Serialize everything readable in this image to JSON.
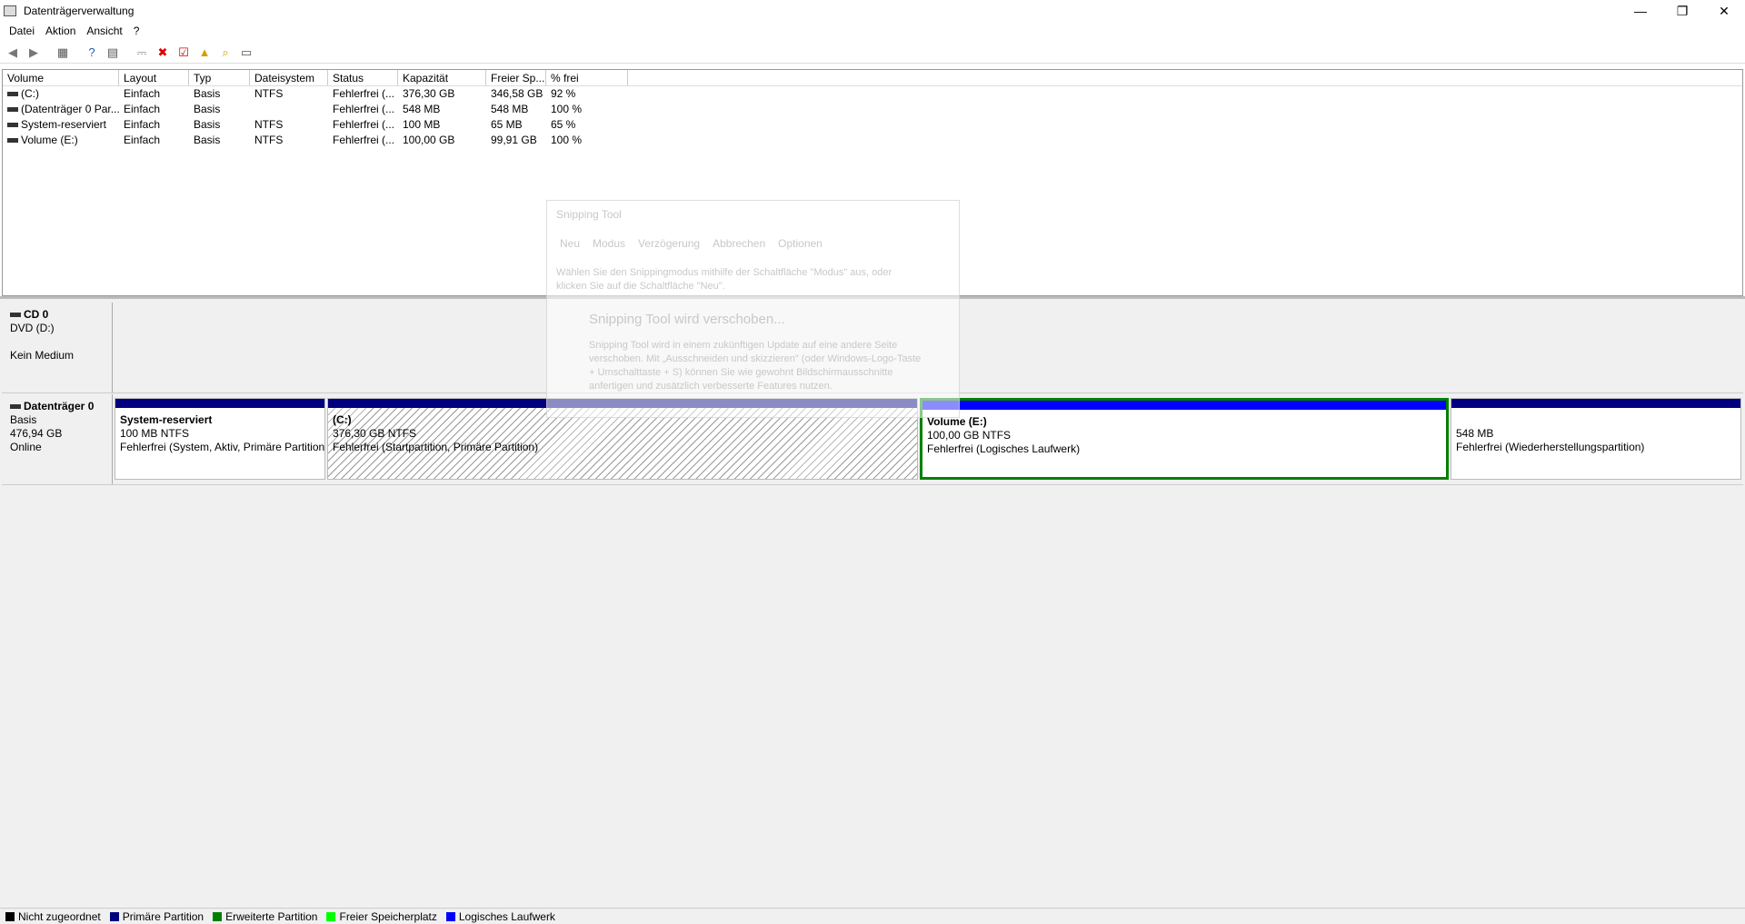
{
  "window": {
    "title": "Datenträgerverwaltung",
    "minimize": "—",
    "maximize": "❐",
    "close": "✕"
  },
  "menu": [
    "Datei",
    "Aktion",
    "Ansicht",
    "?"
  ],
  "columns": [
    "Volume",
    "Layout",
    "Typ",
    "Dateisystem",
    "Status",
    "Kapazität",
    "Freier Sp...",
    "% frei"
  ],
  "volumes": [
    [
      "(C:)",
      "Einfach",
      "Basis",
      "NTFS",
      "Fehlerfrei (...",
      "376,30 GB",
      "346,58 GB",
      "92 %"
    ],
    [
      "(Datenträger 0 Par...",
      "Einfach",
      "Basis",
      "",
      "Fehlerfrei (...",
      "548 MB",
      "548 MB",
      "100 %"
    ],
    [
      "System-reserviert",
      "Einfach",
      "Basis",
      "NTFS",
      "Fehlerfrei (...",
      "100 MB",
      "65 MB",
      "65 %"
    ],
    [
      "Volume (E:)",
      "Einfach",
      "Basis",
      "NTFS",
      "Fehlerfrei (...",
      "100,00 GB",
      "99,91 GB",
      "100 %"
    ]
  ],
  "cd": {
    "name": "CD 0",
    "drive": "DVD (D:)",
    "media": "Kein Medium"
  },
  "disk0": {
    "name": "Datenträger 0",
    "type": "Basis",
    "size": "476,94 GB",
    "state": "Online",
    "partitions": [
      {
        "name": "System-reserviert",
        "size": "100 MB NTFS",
        "status": "Fehlerfrei (System, Aktiv, Primäre Partition)",
        "bar": "#00007f"
      },
      {
        "name": "(C:)",
        "size": "376,30 GB NTFS",
        "status": "Fehlerfrei (Startpartition, Primäre Partition)",
        "bar": "#00007f"
      },
      {
        "name": "Volume  (E:)",
        "size": "100,00 GB NTFS",
        "status": "Fehlerfrei (Logisches Laufwerk)",
        "bar": "#0000ff"
      },
      {
        "name": "",
        "size": "548 MB",
        "status": "Fehlerfrei (Wiederherstellungspartition)",
        "bar": "#00007f"
      }
    ]
  },
  "legend": [
    {
      "label": "Nicht zugeordnet",
      "color": "#000000"
    },
    {
      "label": "Primäre Partition",
      "color": "#00007f"
    },
    {
      "label": "Erweiterte Partition",
      "color": "#008000"
    },
    {
      "label": "Freier Speicherplatz",
      "color": "#00ff00"
    },
    {
      "label": "Logisches Laufwerk",
      "color": "#0000ff"
    }
  ],
  "snipping": {
    "title": "Snipping Tool",
    "toolbar": [
      "Neu",
      "Modus",
      "Verzögerung",
      "Abbrechen",
      "Optionen"
    ],
    "hint": "Wählen Sie den Snippingmodus mithilfe der Schaltfläche \"Modus\" aus, oder klicken Sie auf die Schaltfläche \"Neu\".",
    "heading": "Snipping Tool wird verschoben...",
    "body": "Snipping Tool wird in einem zukünftigen Update auf eine andere Seite verschoben. Mit „Ausschneiden und skizzieren\" (oder Windows-Logo-Taste + Umschalttaste + S) können Sie wie gewohnt Bildschirmausschnitte anfertigen und zusätzlich verbesserte Features nutzen."
  }
}
